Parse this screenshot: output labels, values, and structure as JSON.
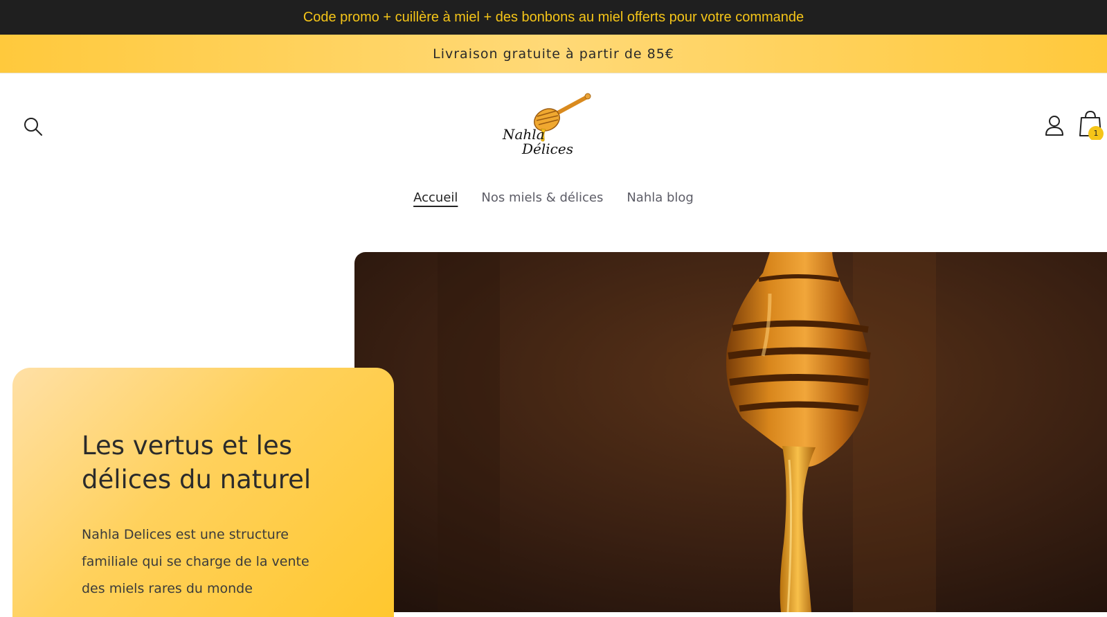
{
  "announcement": {
    "promo_text": "Code promo + cuillère à miel + des bonbons au miel offerts pour votre commande",
    "shipping_text": "Livraison gratuite à partir de 85€"
  },
  "header": {
    "logo_line1": "Nahla",
    "logo_line2": "Délices",
    "search_icon": "search-icon",
    "account_icon": "user-icon",
    "cart_icon": "bag-icon",
    "cart_count": "1"
  },
  "nav": {
    "items": [
      {
        "label": "Accueil",
        "active": true
      },
      {
        "label": "Nos miels & délices",
        "active": false
      },
      {
        "label": "Nahla blog",
        "active": false
      }
    ]
  },
  "hero": {
    "title": "Les vertus et les délices du naturel",
    "text": "Nahla Delices est une structure familiale qui se charge de la vente des miels rares du monde"
  },
  "colors": {
    "promo_bg": "#1f1f1f",
    "promo_text": "#f5c518",
    "shipping_bg": "#ffc93c",
    "card_bg": "#ffd15c"
  }
}
